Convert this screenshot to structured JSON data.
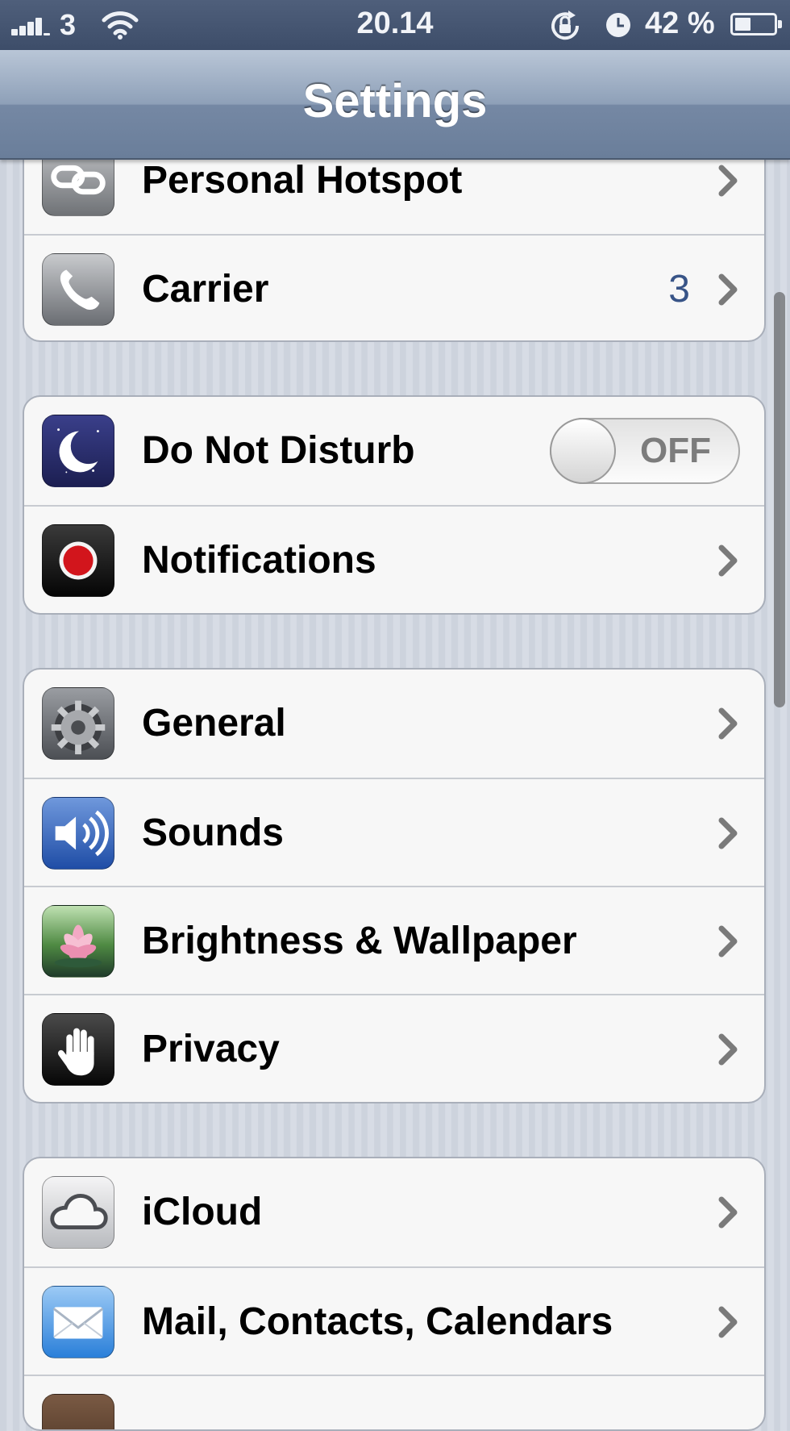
{
  "status_bar": {
    "carrier": "3",
    "time": "20.14",
    "battery_percent": "42 %",
    "battery_level": 0.42,
    "icons": [
      "signal-bars-icon",
      "wifi-icon",
      "rotation-lock-icon",
      "alarm-clock-icon",
      "battery-icon"
    ]
  },
  "nav": {
    "title": "Settings"
  },
  "groups": [
    {
      "rows": [
        {
          "label": "Personal Hotspot",
          "icon": "personal-hotspot-icon",
          "accessory": "chevron"
        },
        {
          "label": "Carrier",
          "value": "3",
          "icon": "phone-icon",
          "accessory": "chevron"
        }
      ]
    },
    {
      "rows": [
        {
          "label": "Do Not Disturb",
          "icon": "moon-icon",
          "toggle": "OFF",
          "toggle_on": false
        },
        {
          "label": "Notifications",
          "icon": "notifications-icon",
          "accessory": "chevron"
        }
      ]
    },
    {
      "rows": [
        {
          "label": "General",
          "icon": "gear-icon",
          "accessory": "chevron"
        },
        {
          "label": "Sounds",
          "icon": "speaker-icon",
          "accessory": "chevron"
        },
        {
          "label": "Brightness & Wallpaper",
          "icon": "flower-icon",
          "accessory": "chevron"
        },
        {
          "label": "Privacy",
          "icon": "hand-icon",
          "accessory": "chevron"
        }
      ]
    },
    {
      "rows": [
        {
          "label": "iCloud",
          "icon": "cloud-icon",
          "accessory": "chevron"
        },
        {
          "label": "Mail, Contacts, Calendars",
          "icon": "mail-icon",
          "accessory": "chevron"
        }
      ]
    }
  ],
  "colors": {
    "value_text": "#385487",
    "nav_title": "#ffffff"
  }
}
